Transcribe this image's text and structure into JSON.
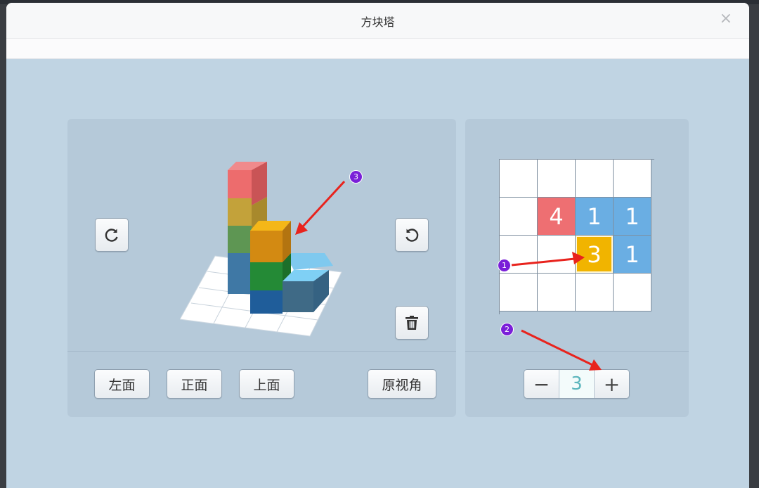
{
  "window": {
    "title": "方块塔",
    "close_glyph": "×"
  },
  "left_panel": {
    "rotate_right_icon": "rotate-clockwise-icon",
    "rotate_left_icon": "rotate-counterclockwise-icon",
    "delete_icon": "trash-icon",
    "views": [
      "左面",
      "正面",
      "上面"
    ],
    "reset_view": "原视角"
  },
  "right_panel": {
    "grid": [
      [
        "",
        "",
        "",
        ""
      ],
      [
        "",
        "4",
        "1",
        "1"
      ],
      [
        "",
        "",
        "3",
        "1"
      ],
      [
        "",
        "",
        "",
        ""
      ]
    ],
    "selected_cell": "3",
    "stepper": {
      "minus": "−",
      "value": "3",
      "plus": "+"
    }
  },
  "annotations": {
    "markers": [
      "1",
      "2",
      "3"
    ],
    "color": "#7a1fd8",
    "arrow_color": "#e8231d"
  },
  "colors": {
    "background": "#c0d4e3",
    "panel": "#b5c9d9",
    "cell_red": "#ee6f72",
    "cell_blue": "#6aaee3",
    "cell_yellow": "#f1b400"
  }
}
